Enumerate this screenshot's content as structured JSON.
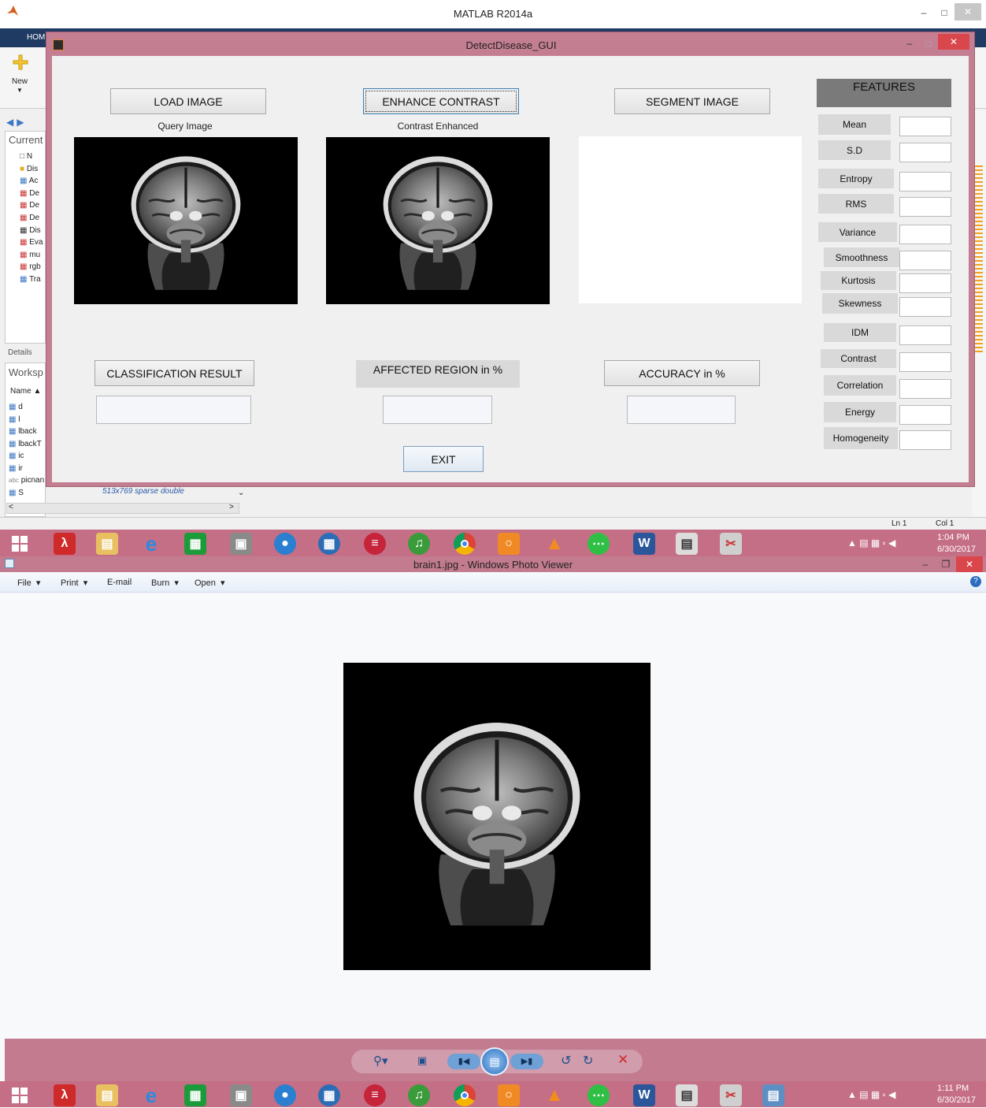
{
  "matlab": {
    "title": "MATLAB R2014a",
    "tab_home": "HOM",
    "new_label": "New",
    "current_label": "Current",
    "details_label": "Details",
    "workspace_label": "Worksp",
    "name_col": "Name ▲",
    "files": [
      "N",
      "Dis",
      "Ac",
      "De",
      "De",
      "De",
      "Dis",
      "Eva",
      "mu",
      "rgb",
      "Tra"
    ],
    "workspace_vars": [
      "d",
      "l",
      "lback",
      "lbackT",
      "ic",
      "ir",
      "picnan",
      "S"
    ],
    "sparse_info": "513x769 sparse double",
    "status_ln": "Ln  1",
    "status_col": "Col  1"
  },
  "gui": {
    "title": "DetectDisease_GUI",
    "load_image": "LOAD IMAGE",
    "enhance_contrast": "ENHANCE CONTRAST",
    "segment_image": "SEGMENT IMAGE",
    "query_caption": "Query Image",
    "contrast_caption": "Contrast Enhanced",
    "features_title": "FEATURES",
    "features": [
      "Mean",
      "S.D",
      "Entropy",
      "RMS",
      "Variance",
      "Smoothness",
      "Kurtosis",
      "Skewness",
      "IDM",
      "Contrast",
      "Correlation",
      "Energy",
      "Homogeneity"
    ],
    "classification_result": "CLASSIFICATION RESULT",
    "affected_region": "AFFECTED REGION in %",
    "accuracy": "ACCURACY in %",
    "exit": "EXIT"
  },
  "taskbar1": {
    "time": "1:04 PM",
    "date": "6/30/2017"
  },
  "viewer": {
    "title": "brain1.jpg - Windows Photo Viewer",
    "menu": [
      "File",
      "Print",
      "E-mail",
      "Burn",
      "Open"
    ]
  },
  "taskbar2": {
    "time": "1:11 PM",
    "date": "6/30/2017"
  },
  "colors": {
    "gui_frame": "#c47e92",
    "taskbar": "#c56f86",
    "viewer_bar": "#c27b8f",
    "features_header": "#7a7a7a"
  }
}
